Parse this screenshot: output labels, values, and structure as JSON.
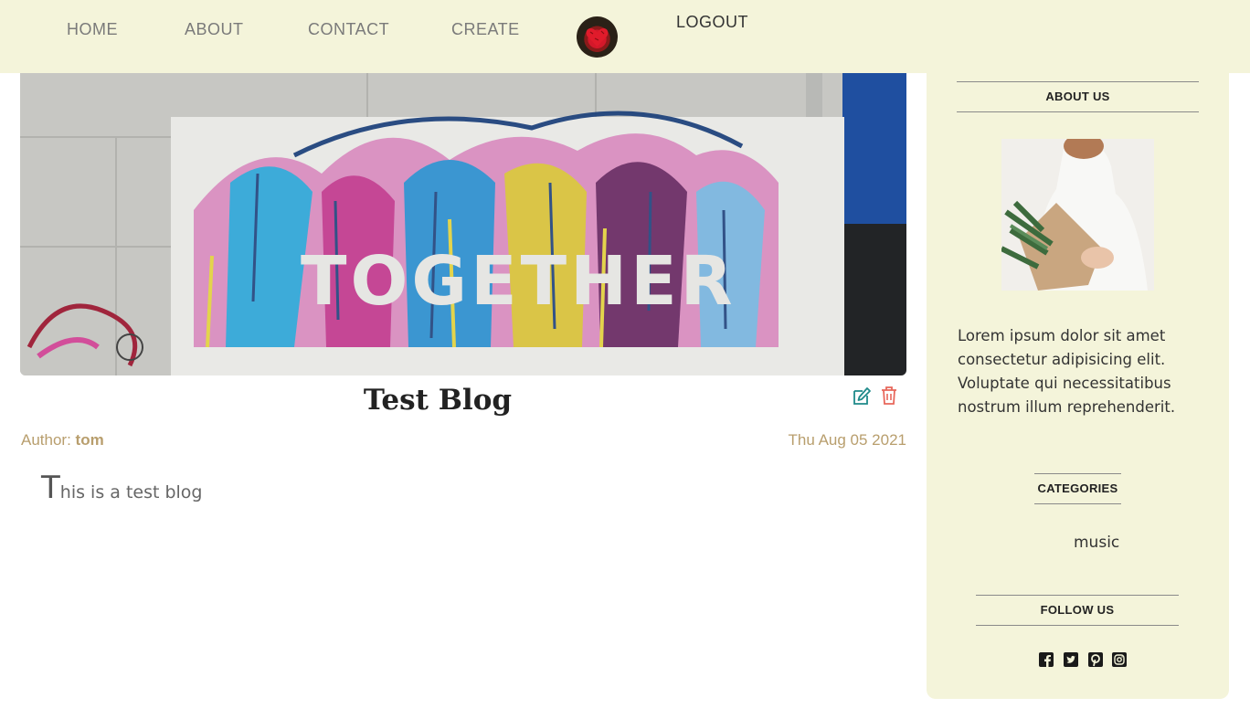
{
  "nav": {
    "home": "HOME",
    "about": "ABOUT",
    "contact": "CONTACT",
    "create": "CREATE",
    "logout": "LOGOUT",
    "avatar_icon": "user-avatar-heart-icon"
  },
  "hero": {
    "image_text": "TOGETHER"
  },
  "post": {
    "title": "Test Blog",
    "author_label": "Author: ",
    "author_name": "tom",
    "date": "Thu Aug 05 2021",
    "body_first_letter": "T",
    "body_rest": "his is a test blog",
    "edit_icon": "edit-icon",
    "delete_icon": "trash-icon"
  },
  "sidebar": {
    "about_heading": "ABOUT US",
    "about_text": "Lorem ipsum dolor sit amet consectetur adipisicing elit. Voluptate qui necessitatibus nostrum illum reprehenderit.",
    "categories_heading": "CATEGORIES",
    "categories": [
      "music"
    ],
    "follow_heading": "FOLLOW US",
    "social_icons": [
      "facebook-square-icon",
      "twitter-square-icon",
      "pinterest-square-icon",
      "instagram-square-icon"
    ]
  },
  "colors": {
    "nav_bg": "#f4f4da",
    "accent_gold": "#b89e6d",
    "edit_teal": "#1f8a8a",
    "delete_red": "#e8675b"
  }
}
